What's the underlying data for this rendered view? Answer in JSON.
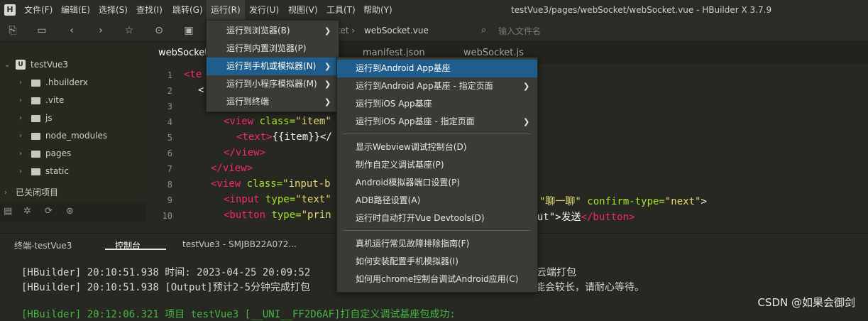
{
  "menubar": {
    "items": [
      "文件(F)",
      "编辑(E)",
      "选择(S)",
      "查找(I)",
      "跳转(G)",
      "运行(R)",
      "发行(U)",
      "视图(V)",
      "工具(T)",
      "帮助(Y)"
    ],
    "title": "testVue3/pages/webSocket/webSocket.vue - HBuilder X 3.7.9",
    "logo": "H"
  },
  "toolbar": {
    "breadcrumb_sep": "ket ›",
    "breadcrumb_file": "webSocket.vue",
    "file_search_placeholder": "输入文件名"
  },
  "sidebar": {
    "project": "testVue3",
    "project_icon": "U",
    "items": [
      ".hbuilderx",
      ".vite",
      "js",
      "node_modules",
      "pages",
      "static"
    ],
    "closed_projects": "已关闭项目"
  },
  "editor_tabs": [
    "webSocket",
    "manifest.json",
    "webSocket.js"
  ],
  "editor": {
    "line_numbers": [
      "1",
      "2",
      "3",
      "4",
      "5",
      "6",
      "7",
      "8",
      "9",
      "10"
    ],
    "line1": "<te",
    "line2": "<",
    "line4_tag": "<view",
    "line4_attr": " class=",
    "line4_str": "\"item\"",
    "line5_a": "<text>",
    "line5_b": "{{item}}</",
    "line6": "</view>",
    "line7": "</view>",
    "line8_tag": "<view",
    "line8_attr": " class=",
    "line8_str": "\"input-b",
    "line9_tag": "<input",
    "line9_attr": " type=",
    "line9_str": "\"text\"",
    "line9_right_str": "\"聊一聊\"",
    "line9_right_attr": " confirm-type=",
    "line9_right_str2": "\"next\"",
    "line9_right_end": ">",
    "line10_tag": "<button",
    "line10_attr": " type=",
    "line10_str": "\"prin",
    "line10_right_plain": "dBut\">发送",
    "line10_right_tag": "</button>"
  },
  "panel": {
    "tabs": [
      "终端-testVue3",
      "控制台",
      "testVue3 - SMJBB22A072..."
    ],
    "console": [
      "[HBuilder] 20:10:51.938 时间: 2023-04-25 20:09:52",
      "[HBuilder] 20:10:51.938 [Output]预计2-5分钟完成打包",
      "[HBuilder] 20:12:06.321 项目 testVue3 [__UNI__FF2D6AF]打自定义调试基座包成功:"
    ],
    "console_right_1": "云端打包",
    "console_right_2": "可能会较长，请耐心等待。",
    "watermark": "CSDN @如果会御剑"
  },
  "run_menu": {
    "items": [
      {
        "label": "运行到浏览器(B)",
        "submenu": true
      },
      {
        "label": "运行到内置浏览器(P)",
        "submenu": false
      },
      {
        "label": "运行到手机或模拟器(N)",
        "submenu": true
      },
      {
        "label": "运行到小程序模拟器(M)",
        "submenu": true
      },
      {
        "label": "运行到终端",
        "submenu": true
      }
    ]
  },
  "sub_menu": {
    "items": [
      {
        "label": "运行到Android App基座",
        "submenu": false
      },
      {
        "label": "运行到Android App基座 - 指定页面",
        "submenu": true
      },
      {
        "label": "运行到iOS App基座",
        "submenu": false
      },
      {
        "label": "运行到iOS App基座 - 指定页面",
        "submenu": true
      },
      {
        "label": "显示Webview调试控制台(D)",
        "submenu": false
      },
      {
        "label": "制作自定义调试基座(P)",
        "submenu": false
      },
      {
        "label": "Android模拟器端口设置(P)",
        "submenu": false
      },
      {
        "label": "ADB路径设置(A)",
        "submenu": false
      },
      {
        "label": "运行时自动打开Vue Devtools(D)",
        "submenu": false
      },
      {
        "label": "真机运行常见故障排除指南(F)",
        "submenu": false
      },
      {
        "label": "如何安装配置手机模拟器(I)",
        "submenu": false
      },
      {
        "label": "如何用chrome控制台调试Android应用(C)",
        "submenu": false
      }
    ]
  },
  "colors": {
    "highlight": "#1f5e8c",
    "console_green": "#47b447",
    "tag": "#f92672",
    "attr": "#a6e22e",
    "string": "#e6db74"
  }
}
